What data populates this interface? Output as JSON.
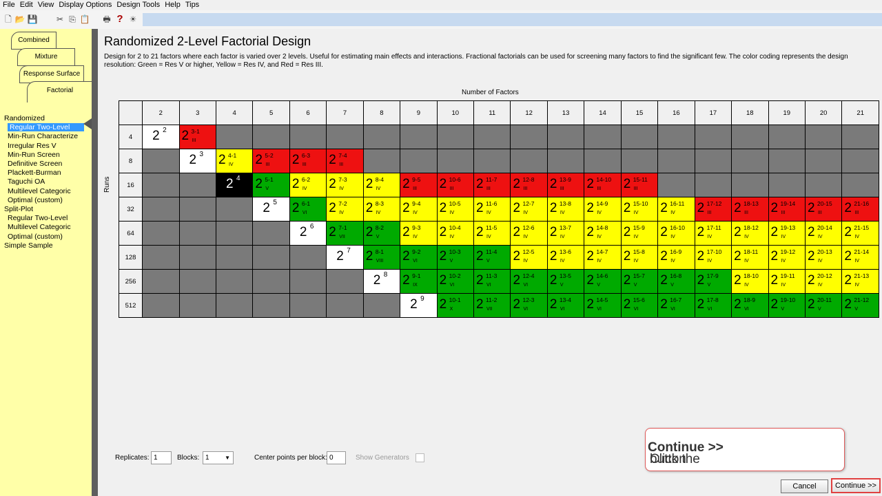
{
  "menu": [
    "File",
    "Edit",
    "View",
    "Display Options",
    "Design Tools",
    "Help",
    "Tips"
  ],
  "toolbar_icons": [
    "new-icon",
    "open-icon",
    "save-icon",
    "cut-icon",
    "copy-icon",
    "paste-icon",
    "print-icon",
    "help-icon",
    "tip-icon"
  ],
  "tabs": [
    "Combined",
    "Mixture",
    "Response Surface",
    "Factorial"
  ],
  "nav": [
    {
      "label": "Randomized",
      "indent": 0,
      "sel": false
    },
    {
      "label": "Regular Two-Level",
      "indent": 1,
      "sel": true
    },
    {
      "label": "Min-Run Characterize",
      "indent": 1,
      "sel": false
    },
    {
      "label": "Irregular Res V",
      "indent": 1,
      "sel": false
    },
    {
      "label": "Min-Run Screen",
      "indent": 1,
      "sel": false
    },
    {
      "label": "Definitive Screen",
      "indent": 1,
      "sel": false
    },
    {
      "label": "Plackett-Burman",
      "indent": 1,
      "sel": false
    },
    {
      "label": "Taguchi OA",
      "indent": 1,
      "sel": false
    },
    {
      "label": "Multilevel Categoric",
      "indent": 1,
      "sel": false
    },
    {
      "label": "Optimal (custom)",
      "indent": 1,
      "sel": false
    },
    {
      "label": "Split-Plot",
      "indent": 0,
      "sel": false
    },
    {
      "label": "Regular Two-Level",
      "indent": 1,
      "sel": false
    },
    {
      "label": "Multilevel Categoric",
      "indent": 1,
      "sel": false
    },
    {
      "label": "Optimal (custom)",
      "indent": 1,
      "sel": false
    },
    {
      "label": "Simple Sample",
      "indent": 0,
      "sel": false
    }
  ],
  "title": "Randomized 2-Level Factorial Design",
  "description": "Design for 2 to 21 factors where each factor is varied over 2 levels.  Useful for estimating main effects and interactions.  Fractional factorials can be used for screening many factors to find the significant few. The color coding represents the design resolution: Green = Res V or higher, Yellow = Res IV, and Red = Res III.",
  "axis_top": "Number of Factors",
  "axis_left": "Runs",
  "factors": [
    "2",
    "3",
    "4",
    "5",
    "6",
    "7",
    "8",
    "9",
    "10",
    "11",
    "12",
    "13",
    "14",
    "15",
    "16",
    "17",
    "18",
    "19",
    "20",
    "21"
  ],
  "runs": [
    "4",
    "8",
    "16",
    "32",
    "64",
    "128",
    "256",
    "512"
  ],
  "colors": {
    "red": "#ee1111",
    "yellow": "#ffff00",
    "green": "#00aa00",
    "gray": "#7a7a7a",
    "white": "#ffffff",
    "black": "#000000"
  },
  "rows": [
    [
      [
        "white",
        "2",
        "2",
        ""
      ],
      [
        "red",
        "2",
        "3-1",
        "III"
      ],
      [
        "gray"
      ],
      [
        "gray"
      ],
      [
        "gray"
      ],
      [
        "gray"
      ],
      [
        "gray"
      ],
      [
        "gray"
      ],
      [
        "gray"
      ],
      [
        "gray"
      ],
      [
        "gray"
      ],
      [
        "gray"
      ],
      [
        "gray"
      ],
      [
        "gray"
      ],
      [
        "gray"
      ],
      [
        "gray"
      ],
      [
        "gray"
      ],
      [
        "gray"
      ],
      [
        "gray"
      ],
      [
        "gray"
      ]
    ],
    [
      [
        "gray"
      ],
      [
        "white",
        "2",
        "3",
        ""
      ],
      [
        "yellow",
        "2",
        "4-1",
        "IV"
      ],
      [
        "red",
        "2",
        "5-2",
        "III"
      ],
      [
        "red",
        "2",
        "6-3",
        "III"
      ],
      [
        "red",
        "2",
        "7-4",
        "III"
      ],
      [
        "gray"
      ],
      [
        "gray"
      ],
      [
        "gray"
      ],
      [
        "gray"
      ],
      [
        "gray"
      ],
      [
        "gray"
      ],
      [
        "gray"
      ],
      [
        "gray"
      ],
      [
        "gray"
      ],
      [
        "gray"
      ],
      [
        "gray"
      ],
      [
        "gray"
      ],
      [
        "gray"
      ],
      [
        "gray"
      ]
    ],
    [
      [
        "gray"
      ],
      [
        "gray"
      ],
      [
        "black",
        "2",
        "4",
        ""
      ],
      [
        "green",
        "2",
        "5-1",
        "V"
      ],
      [
        "yellow",
        "2",
        "6-2",
        "IV"
      ],
      [
        "yellow",
        "2",
        "7-3",
        "IV"
      ],
      [
        "yellow",
        "2",
        "8-4",
        "IV"
      ],
      [
        "red",
        "2",
        "9-5",
        "III"
      ],
      [
        "red",
        "2",
        "10-6",
        "III"
      ],
      [
        "red",
        "2",
        "11-7",
        "III"
      ],
      [
        "red",
        "2",
        "12-8",
        "III"
      ],
      [
        "red",
        "2",
        "13-9",
        "III"
      ],
      [
        "red",
        "2",
        "14-10",
        "III"
      ],
      [
        "red",
        "2",
        "15-11",
        "III"
      ],
      [
        "gray"
      ],
      [
        "gray"
      ],
      [
        "gray"
      ],
      [
        "gray"
      ],
      [
        "gray"
      ],
      [
        "gray"
      ]
    ],
    [
      [
        "gray"
      ],
      [
        "gray"
      ],
      [
        "gray"
      ],
      [
        "white",
        "2",
        "5",
        ""
      ],
      [
        "green",
        "2",
        "6-1",
        "VI"
      ],
      [
        "yellow",
        "2",
        "7-2",
        "IV"
      ],
      [
        "yellow",
        "2",
        "8-3",
        "IV"
      ],
      [
        "yellow",
        "2",
        "9-4",
        "IV"
      ],
      [
        "yellow",
        "2",
        "10-5",
        "IV"
      ],
      [
        "yellow",
        "2",
        "11-6",
        "IV"
      ],
      [
        "yellow",
        "2",
        "12-7",
        "IV"
      ],
      [
        "yellow",
        "2",
        "13-8",
        "IV"
      ],
      [
        "yellow",
        "2",
        "14-9",
        "IV"
      ],
      [
        "yellow",
        "2",
        "15-10",
        "IV"
      ],
      [
        "yellow",
        "2",
        "16-11",
        "IV"
      ],
      [
        "red",
        "2",
        "17-12",
        "III"
      ],
      [
        "red",
        "2",
        "18-13",
        "III"
      ],
      [
        "red",
        "2",
        "19-14",
        "III"
      ],
      [
        "red",
        "2",
        "20-15",
        "III"
      ],
      [
        "red",
        "2",
        "21-16",
        "III"
      ]
    ],
    [
      [
        "gray"
      ],
      [
        "gray"
      ],
      [
        "gray"
      ],
      [
        "gray"
      ],
      [
        "white",
        "2",
        "6",
        ""
      ],
      [
        "green",
        "2",
        "7-1",
        "VII"
      ],
      [
        "green",
        "2",
        "8-2",
        "V"
      ],
      [
        "yellow",
        "2",
        "9-3",
        "IV"
      ],
      [
        "yellow",
        "2",
        "10-4",
        "IV"
      ],
      [
        "yellow",
        "2",
        "11-5",
        "IV"
      ],
      [
        "yellow",
        "2",
        "12-6",
        "IV"
      ],
      [
        "yellow",
        "2",
        "13-7",
        "IV"
      ],
      [
        "yellow",
        "2",
        "14-8",
        "IV"
      ],
      [
        "yellow",
        "2",
        "15-9",
        "IV"
      ],
      [
        "yellow",
        "2",
        "16-10",
        "IV"
      ],
      [
        "yellow",
        "2",
        "17-11",
        "IV"
      ],
      [
        "yellow",
        "2",
        "18-12",
        "IV"
      ],
      [
        "yellow",
        "2",
        "19-13",
        "IV"
      ],
      [
        "yellow",
        "2",
        "20-14",
        "IV"
      ],
      [
        "yellow",
        "2",
        "21-15",
        "IV"
      ]
    ],
    [
      [
        "gray"
      ],
      [
        "gray"
      ],
      [
        "gray"
      ],
      [
        "gray"
      ],
      [
        "gray"
      ],
      [
        "white",
        "2",
        "7",
        ""
      ],
      [
        "green",
        "2",
        "8-1",
        "VIII"
      ],
      [
        "green",
        "2",
        "9-2",
        "VI"
      ],
      [
        "green",
        "2",
        "10-3",
        "V"
      ],
      [
        "green",
        "2",
        "11-4",
        "V"
      ],
      [
        "yellow",
        "2",
        "12-5",
        "IV"
      ],
      [
        "yellow",
        "2",
        "13-6",
        "IV"
      ],
      [
        "yellow",
        "2",
        "14-7",
        "IV"
      ],
      [
        "yellow",
        "2",
        "15-8",
        "IV"
      ],
      [
        "yellow",
        "2",
        "16-9",
        "IV"
      ],
      [
        "yellow",
        "2",
        "17-10",
        "IV"
      ],
      [
        "yellow",
        "2",
        "18-11",
        "IV"
      ],
      [
        "yellow",
        "2",
        "19-12",
        "IV"
      ],
      [
        "yellow",
        "2",
        "20-13",
        "IV"
      ],
      [
        "yellow",
        "2",
        "21-14",
        "IV"
      ]
    ],
    [
      [
        "gray"
      ],
      [
        "gray"
      ],
      [
        "gray"
      ],
      [
        "gray"
      ],
      [
        "gray"
      ],
      [
        "gray"
      ],
      [
        "white",
        "2",
        "8",
        ""
      ],
      [
        "green",
        "2",
        "9-1",
        "IX"
      ],
      [
        "green",
        "2",
        "10-2",
        "VI"
      ],
      [
        "green",
        "2",
        "11-3",
        "VI"
      ],
      [
        "green",
        "2",
        "12-4",
        "VI"
      ],
      [
        "green",
        "2",
        "13-5",
        "V"
      ],
      [
        "green",
        "2",
        "14-6",
        "V"
      ],
      [
        "green",
        "2",
        "15-7",
        "V"
      ],
      [
        "green",
        "2",
        "16-8",
        "V"
      ],
      [
        "green",
        "2",
        "17-9",
        "V"
      ],
      [
        "yellow",
        "2",
        "18-10",
        "IV"
      ],
      [
        "yellow",
        "2",
        "19-11",
        "IV"
      ],
      [
        "yellow",
        "2",
        "20-12",
        "IV"
      ],
      [
        "yellow",
        "2",
        "21-13",
        "IV"
      ]
    ],
    [
      [
        "gray"
      ],
      [
        "gray"
      ],
      [
        "gray"
      ],
      [
        "gray"
      ],
      [
        "gray"
      ],
      [
        "gray"
      ],
      [
        "gray"
      ],
      [
        "white",
        "2",
        "9",
        ""
      ],
      [
        "green",
        "2",
        "10-1",
        "X"
      ],
      [
        "green",
        "2",
        "11-2",
        "VII"
      ],
      [
        "green",
        "2",
        "12-3",
        "VI"
      ],
      [
        "green",
        "2",
        "13-4",
        "VI"
      ],
      [
        "green",
        "2",
        "14-5",
        "VI"
      ],
      [
        "green",
        "2",
        "15-6",
        "VI"
      ],
      [
        "green",
        "2",
        "16-7",
        "VI"
      ],
      [
        "green",
        "2",
        "17-8",
        "VI"
      ],
      [
        "green",
        "2",
        "18-9",
        "VI"
      ],
      [
        "green",
        "2",
        "19-10",
        "V"
      ],
      [
        "green",
        "2",
        "20-11",
        "V"
      ],
      [
        "green",
        "2",
        "21-12",
        "V"
      ]
    ]
  ],
  "bottom": {
    "replicates_label": "Replicates:",
    "replicates_value": "1",
    "blocks_label": "Blocks:",
    "blocks_value": "1",
    "center_label": "Center points per block:",
    "center_value": "0",
    "show_generators": "Show Generators"
  },
  "callout": {
    "pre": "Click the ",
    "bold": "Continue >>",
    "post": " button"
  },
  "buttons": {
    "cancel": "Cancel",
    "continue": "Continue >>"
  }
}
